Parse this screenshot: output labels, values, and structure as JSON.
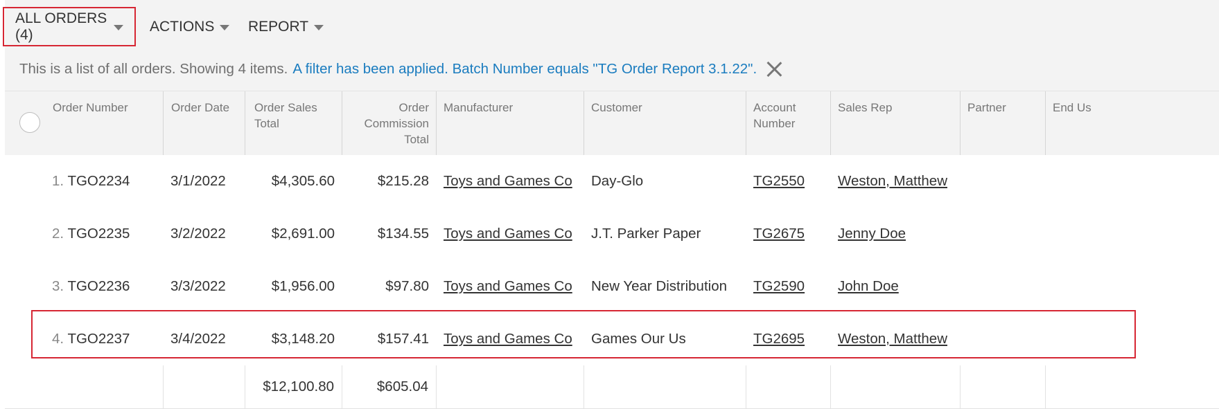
{
  "toolbar": {
    "all_orders_label": "ALL ORDERS (4)",
    "actions_label": "ACTIONS",
    "report_label": "REPORT"
  },
  "info": {
    "text": "This is a list of all orders. Showing 4 items.",
    "filter_text": "A filter has been applied. Batch Number equals \"TG Order Report 3.1.22\"."
  },
  "columns": {
    "order_number": "Order Number",
    "order_date": "Order Date",
    "order_sales_total": "Order Sales Total",
    "order_commission_total": [
      "Order",
      "Commission",
      "Total"
    ],
    "manufacturer": "Manufacturer",
    "customer": "Customer",
    "account_number": [
      "Account",
      "Number"
    ],
    "sales_rep": "Sales Rep",
    "partner": "Partner",
    "end_user": "End Us"
  },
  "rows": [
    {
      "num": "1.",
      "order_number": "TGO2234",
      "order_date": "3/1/2022",
      "sales_total": "$4,305.60",
      "commission_total": "$215.28",
      "manufacturer": "Toys and Games Co",
      "customer": "Day-Glo",
      "account_number": "TG2550",
      "sales_rep": "Weston, Matthew"
    },
    {
      "num": "2.",
      "order_number": "TGO2235",
      "order_date": "3/2/2022",
      "sales_total": "$2,691.00",
      "commission_total": "$134.55",
      "manufacturer": "Toys and Games Co",
      "customer": "J.T. Parker Paper",
      "account_number": "TG2675",
      "sales_rep": "Jenny Doe"
    },
    {
      "num": "3.",
      "order_number": "TGO2236",
      "order_date": "3/3/2022",
      "sales_total": "$1,956.00",
      "commission_total": "$97.80",
      "manufacturer": "Toys and Games Co",
      "customer": "New Year Distribution",
      "account_number": "TG2590",
      "sales_rep": "John Doe"
    },
    {
      "num": "4.",
      "order_number": "TGO2237",
      "order_date": "3/4/2022",
      "sales_total": "$3,148.20",
      "commission_total": "$157.41",
      "manufacturer": "Toys and Games Co",
      "customer": "Games Our Us",
      "account_number": "TG2695",
      "sales_rep": "Weston, Matthew"
    }
  ],
  "totals": {
    "sales_total": "$12,100.80",
    "commission_total": "$605.04"
  },
  "colors": {
    "highlight": "#d62633",
    "filter_link": "#1a7cbf",
    "header_bg": "#f3f3f3"
  }
}
